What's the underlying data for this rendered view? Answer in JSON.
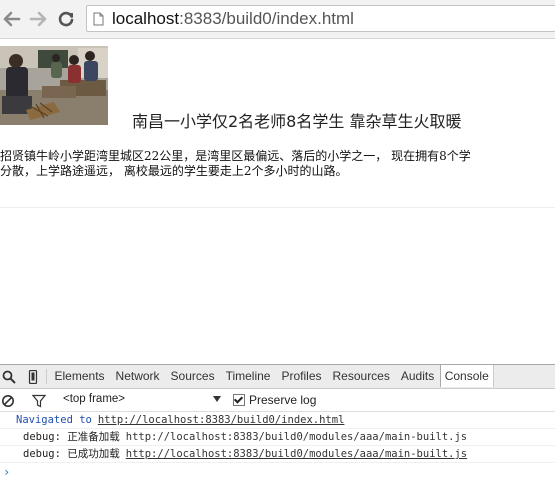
{
  "browser": {
    "url_host": "localhost",
    "url_rest": ":8383/build0/index.html"
  },
  "article": {
    "headline": "南昌一小学仅2名老师8名学生 靠杂草生火取暖",
    "summary_line1": "招贤镇牛岭小学距湾里城区22公里，是湾里区最偏远、落后的小学之一， 现在拥有8个学",
    "summary_line2": "分散，上学路途遥远， 离校最远的学生要走上2个多小时的山路。"
  },
  "devtools": {
    "tabs": [
      "Elements",
      "Network",
      "Sources",
      "Timeline",
      "Profiles",
      "Resources",
      "Audits",
      "Console"
    ],
    "active_tab": "Console",
    "frame_select": "<top frame>",
    "preserve_log_label": "Preserve log",
    "preserve_log_checked": true,
    "console": {
      "navigated_label": "Navigated to",
      "navigated_url": "http://localhost:8383/build0/index.html",
      "lines": [
        {
          "text": "debug: 正准备加载",
          "source": "http://localhost:8383/build0/modules/aaa/main-built.js",
          "underline": false
        },
        {
          "text": "debug: 已成功加载",
          "source": "http://localhost:8383/build0/modules/aaa/main-built.js",
          "underline": true
        }
      ],
      "prompt": "›"
    }
  },
  "icons": {
    "back": "back-arrow-icon",
    "forward": "forward-arrow-icon",
    "reload": "reload-icon",
    "page": "page-icon",
    "inspect": "magnifier-icon",
    "device": "device-mode-icon",
    "clear": "clear-console-icon",
    "filter": "filter-icon"
  },
  "colors": {
    "navigated_text": "#1f4fb0",
    "prompt": "#2f6fd6"
  }
}
